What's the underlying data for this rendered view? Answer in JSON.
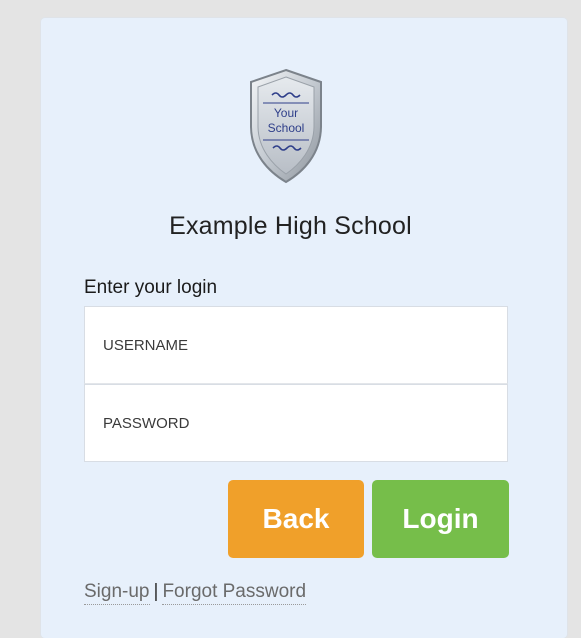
{
  "school": {
    "crest_line1": "Your",
    "crest_line2": "School",
    "name": "Example High School"
  },
  "form": {
    "prompt": "Enter your login",
    "username_placeholder": "USERNAME",
    "password_placeholder": "PASSWORD"
  },
  "buttons": {
    "back_label": "Back",
    "login_label": "Login"
  },
  "links": {
    "signup_label": "Sign-up",
    "separator": "|",
    "forgot_label": "Forgot Password"
  },
  "colors": {
    "panel_bg": "#e7f0fb",
    "back_button": "#f0a02a",
    "login_button": "#76be4a"
  }
}
